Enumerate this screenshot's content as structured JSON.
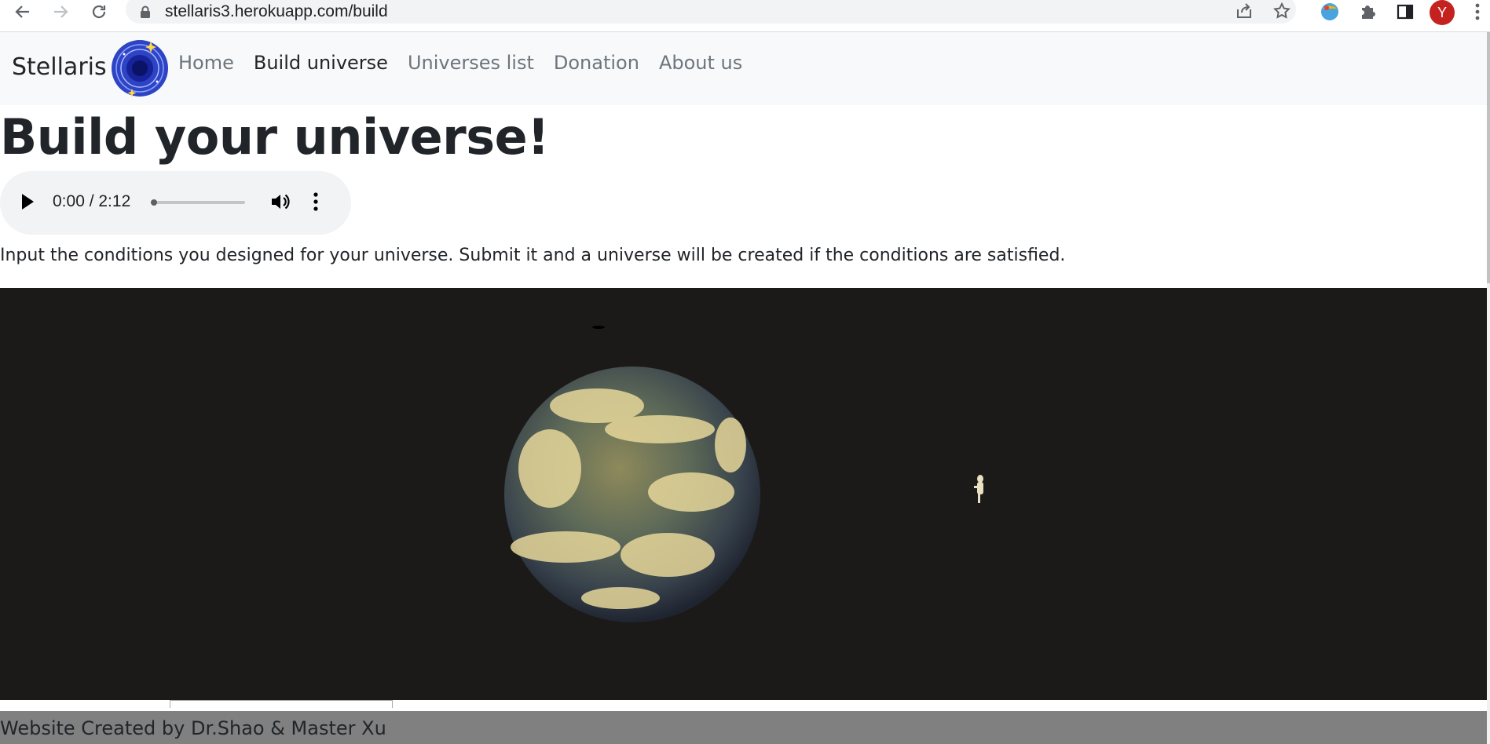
{
  "browser": {
    "url": "stellaris3.herokuapp.com/build",
    "avatar_letter": "Y",
    "icons": [
      "back-arrow-icon",
      "forward-arrow-icon",
      "reload-icon",
      "lock-icon",
      "share-icon",
      "star-icon",
      "extension-icon",
      "puzzle-icon",
      "side-panel-icon",
      "more-vert-icon"
    ]
  },
  "navbar": {
    "brand": "Stellaris",
    "links": [
      "Home",
      "Build universe",
      "Universes list",
      "Donation",
      "About us"
    ],
    "active_index": 1
  },
  "main": {
    "title": "Build your universe!",
    "audio": {
      "time": "0:00 / 2:12",
      "progress": 0.0
    },
    "intro": "Input the conditions you designed for your universe. Submit it and a universe will be created if the conditions are satisfied."
  },
  "footer": {
    "text": "Website Created by Dr.Shao & Master Xu"
  },
  "colors": {
    "navbar_bg": "#f8f9fa",
    "video_bg": "#1b1a19",
    "footer_bg": "#808080",
    "avatar": "#c5221f"
  }
}
